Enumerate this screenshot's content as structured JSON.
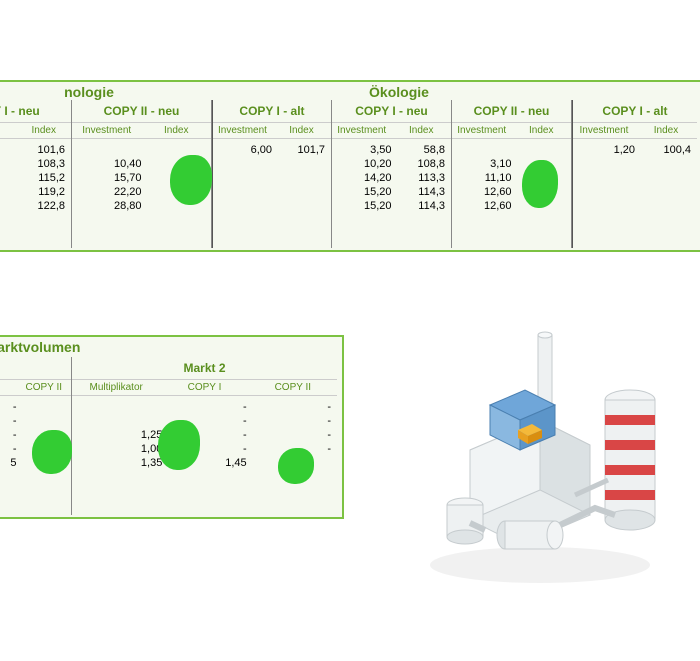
{
  "panel1": {
    "title_tech": "nologie",
    "groups": {
      "tech_c1neu": {
        "label": "Y I - neu",
        "sub": [
          "t",
          "Index"
        ],
        "c2": [
          "101,6",
          "108,3",
          "115,2",
          "119,2",
          "122,8"
        ]
      },
      "tech_c2neu": {
        "label": "COPY II - neu",
        "sub": [
          "Investment",
          "Index"
        ],
        "c1": [
          "",
          "10,40",
          "15,70",
          "22,20",
          "28,80"
        ]
      },
      "oko": {
        "title": "Ökologie"
      },
      "oko_c1alt": {
        "label": "COPY I - alt",
        "sub": [
          "Investment",
          "Index"
        ],
        "c1": [
          "6,00"
        ],
        "c2": [
          "101,7"
        ]
      },
      "oko_c1neu": {
        "label": "COPY I - neu",
        "sub": [
          "Investment",
          "Index"
        ],
        "c1": [
          "3,50",
          "10,20",
          "14,20",
          "15,20",
          "15,20"
        ],
        "c2": [
          "58,8",
          "108,8",
          "113,3",
          "114,3",
          "114,3"
        ]
      },
      "oko_c2neu": {
        "label": "COPY II - neu",
        "sub": [
          "Investment",
          "Index"
        ],
        "c1": [
          "",
          "3,10",
          "11,10",
          "12,60",
          "12,60"
        ]
      },
      "c1alt2": {
        "label": "COPY I - alt",
        "sub": [
          "Investment",
          "Index"
        ],
        "c1": [
          "1,20"
        ],
        "c2": [
          "100,4"
        ]
      }
    }
  },
  "panel2": {
    "title": "es Marktvolumen",
    "m1": {
      "sub": [
        "r",
        "COPY II"
      ],
      "c2vals": [
        "-",
        "-",
        "-",
        "-",
        "5"
      ]
    },
    "m2": {
      "title": "Markt 2",
      "sub": [
        "Multiplikator",
        "COPY I",
        "COPY II"
      ],
      "mult": [
        "",
        "",
        "1,25",
        "1,00",
        "1,35"
      ],
      "c1": [
        "-",
        "-",
        "-",
        "-",
        "-"
      ],
      "c1b": [
        "",
        "",
        "",
        "",
        "1,45"
      ],
      "c2": [
        "-",
        "-",
        "-",
        "-",
        ""
      ]
    }
  }
}
